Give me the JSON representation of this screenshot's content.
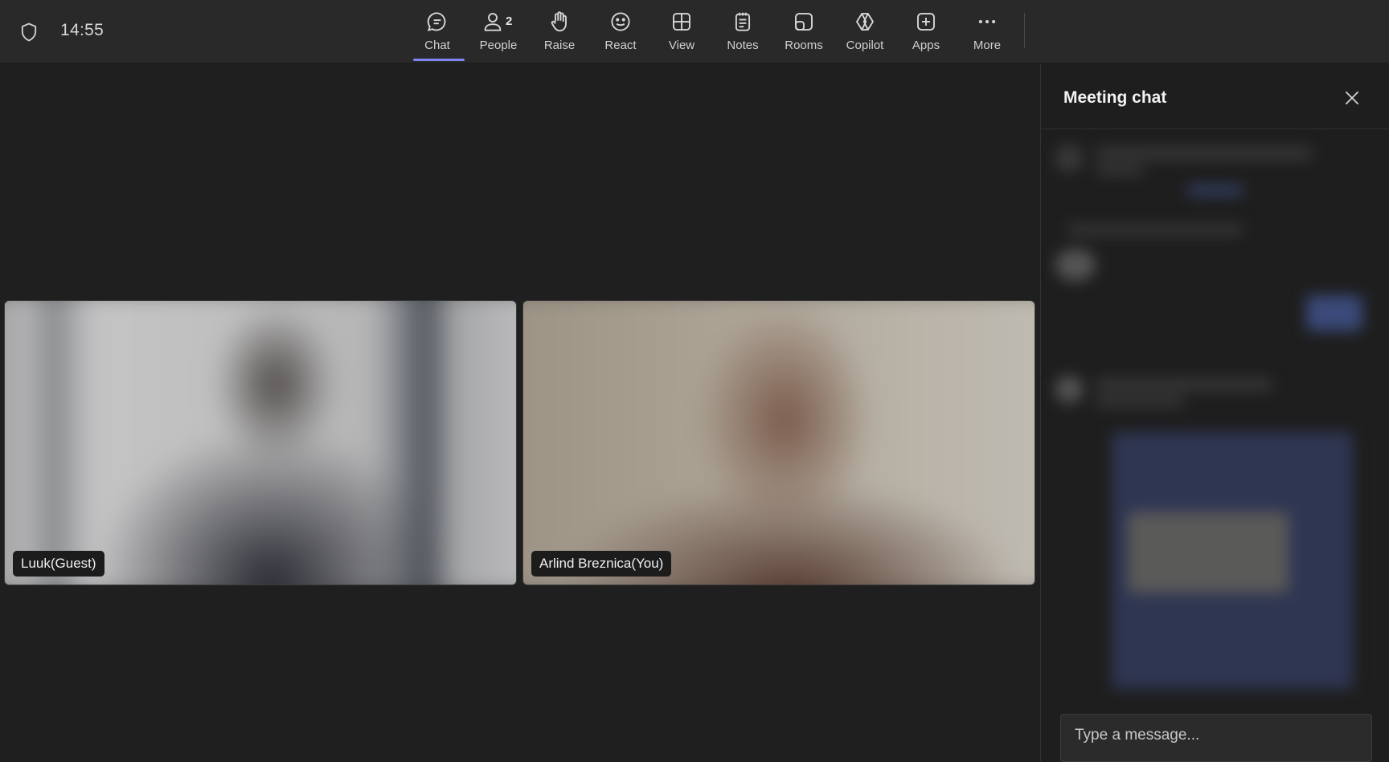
{
  "status": {
    "clock": "14:55",
    "shield_icon": "shield-icon"
  },
  "toolbar": {
    "accent_color": "#7f85f5",
    "active_item": "Chat",
    "items": [
      {
        "label": "Chat",
        "icon": "chat-bubble-icon"
      },
      {
        "label": "People",
        "icon": "people-icon",
        "count": "2"
      },
      {
        "label": "Raise",
        "icon": "raise-hand-icon"
      },
      {
        "label": "React",
        "icon": "emoji-smile-icon"
      },
      {
        "label": "View",
        "icon": "grid-view-icon"
      },
      {
        "label": "Notes",
        "icon": "notes-icon"
      },
      {
        "label": "Rooms",
        "icon": "rooms-icon"
      },
      {
        "label": "Copilot",
        "icon": "copilot-icon"
      },
      {
        "label": "Apps",
        "icon": "add-apps-icon"
      },
      {
        "label": "More",
        "icon": "more-dots-icon"
      }
    ]
  },
  "participants": [
    {
      "name": "Luuk(Guest)"
    },
    {
      "name": "Arlind Breznica(You)"
    }
  ],
  "chat_panel": {
    "title": "Meeting chat",
    "close_icon": "close-icon",
    "input_placeholder": "Type a message..."
  }
}
